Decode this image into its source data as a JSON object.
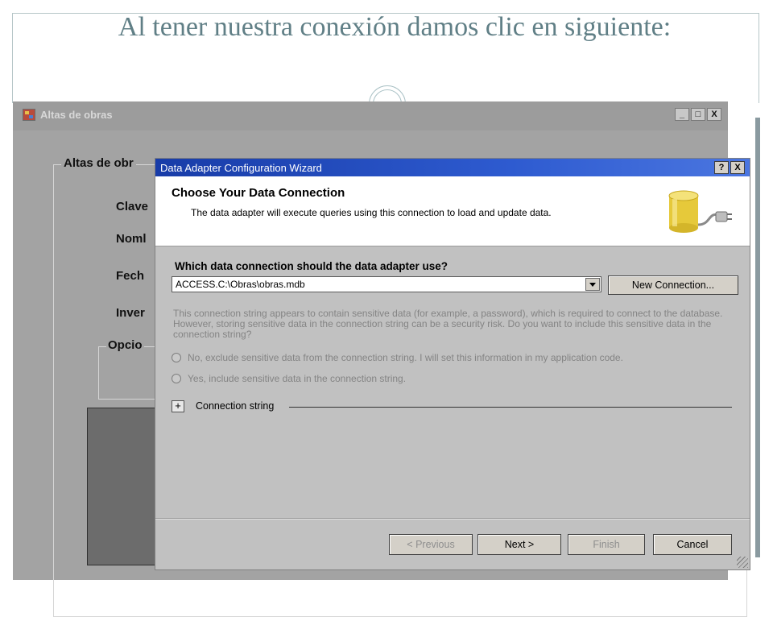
{
  "slide": {
    "title": "Al tener nuestra conexión damos clic en siguiente:"
  },
  "background_window": {
    "title": "Altas de obras",
    "controls": [
      "_",
      "□",
      "X"
    ],
    "group_title": "Altas de obr",
    "labels": [
      "Clave",
      "Noml",
      "Fech",
      "Inver"
    ],
    "inner_group_title": "Opcio"
  },
  "wizard": {
    "title": "Data Adapter Configuration Wizard",
    "controls": [
      "?",
      "X"
    ],
    "header_title": "Choose Your Data Connection",
    "header_subtitle": "The data adapter will execute queries using this connection to load and update data.",
    "question": "Which data connection should the data adapter use?",
    "connection_value": "ACCESS.C:\\Obras\\obras.mdb",
    "new_connection_label": "New Connection...",
    "warning_text": "This connection string appears to contain sensitive data (for example, a password), which is required to connect to the database. However, storing sensitive data in the connection string can be a security risk. Do you want to include this sensitive data in the connection string?",
    "radio_no": "No, exclude sensitive data from the connection string. I will set this information in my application code.",
    "radio_yes": "Yes, include sensitive data in the connection string.",
    "expander_symbol": "+",
    "connection_string_label": "Connection string",
    "buttons": {
      "previous": "< Previous",
      "next": "Next >",
      "finish": "Finish",
      "cancel": "Cancel"
    }
  },
  "colors": {
    "title_text": "#607f86",
    "wizard_titlebar": "#183ca8",
    "dialog_body": "#c1c1c1",
    "db_cylinder": "#e6c93a"
  }
}
